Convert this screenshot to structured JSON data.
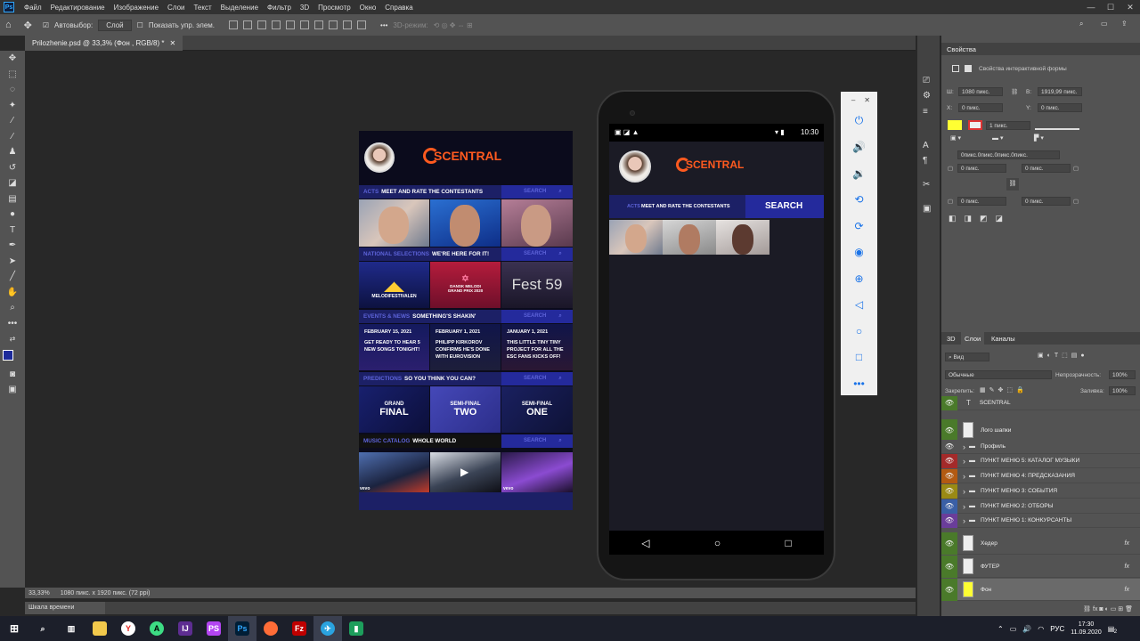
{
  "app": {
    "menu": [
      "Файл",
      "Редактирование",
      "Изображение",
      "Слои",
      "Текст",
      "Выделение",
      "Фильтр",
      "3D",
      "Просмотр",
      "Окно",
      "Справка"
    ]
  },
  "options": {
    "autoselect": "Автовыбор:",
    "layer_select": "Слой",
    "show_controls": "Показать упр. элем.",
    "mode3d": "3D-режим:"
  },
  "document": {
    "tab_title": "Prilozhenie.psd @ 33,3% (Фон , RGB/8) *"
  },
  "status": {
    "zoom": "33,33%",
    "doc_info": "1080 пикс. x 1920 пикс. (72 ppi)"
  },
  "timeline": {
    "label": "Шкала времени"
  },
  "design": {
    "logo": "SCENTRAL",
    "sections": [
      {
        "key": "ACTS",
        "title": "MEET AND RATE THE CONTESTANTS",
        "search": "SEARCH"
      },
      {
        "key": "NATIONAL SELECTIONS",
        "title": "WE'RE HERE FOR IT!",
        "search": "SEARCH"
      },
      {
        "key": "EVENTS & NEWS",
        "title": "SOMETHING'S SHAKIN'",
        "search": "SEARCH"
      },
      {
        "key": "PREDICTIONS",
        "title": "SO YOU THINK YOU CAN?",
        "search": "SEARCH"
      },
      {
        "key": "MUSIC CATALOG",
        "title": "WHOLE WORLD",
        "search": "SEARCH"
      }
    ],
    "selections": [
      "MELODIFESTIVALEN",
      "DANSK MELODI GRAND PRIX 2020",
      "Fest 59"
    ],
    "events": [
      {
        "date": "FEBRUARY 15, 2021",
        "text": "GET READY TO HEAR 5 NEW SONGS TONIGHT!"
      },
      {
        "date": "FEBRUARY 1, 2021",
        "text": "PHILIPP KIRKOROV CONFIRMS HE'S DONE WITH EUROVISION"
      },
      {
        "date": "JANUARY 1, 2021",
        "text": "THIS LITTLE TINY TINY PROJECT FOR ALL THE ESC FANS KICKS OFF!"
      }
    ],
    "predictions": [
      {
        "l1": "GRAND",
        "l2": "FINAL"
      },
      {
        "l1": "SEMI-FINAL",
        "l2": "TWO"
      },
      {
        "l1": "SEMI-FINAL",
        "l2": "ONE"
      }
    ],
    "music_labels": [
      "vevo",
      "vevo",
      "vevo"
    ]
  },
  "phone": {
    "time": "10:30",
    "logo": "SCENTRAL",
    "acts_key": "ACTS",
    "acts_title": "MEET AND RATE THE CONTESTANTS",
    "search": "SEARCH"
  },
  "panel": {
    "tabs": [
      "Свойства"
    ],
    "subtitle": "Свойства интерактивной формы",
    "w_label": "Ш:",
    "w": "1080 пикс.",
    "h_label": "В:",
    "h": "1919,99 пикс.",
    "x_label": "X:",
    "x": "0 пикс.",
    "y_label": "Y:",
    "y": "0 пикс.",
    "stroke": "1 пикс.",
    "radius_all": "0пикс.0пикс.0пикс.0пикс.",
    "r1": "0 пикс.",
    "r2": "0 пикс.",
    "r3": "0 пикс.",
    "r4": "0 пикс."
  },
  "layers_panel": {
    "tabs": [
      "3D",
      "Слои",
      "Каналы"
    ],
    "filter": "Вид",
    "blend": "Обычные",
    "opacity_label": "Непрозрачность:",
    "opacity": "100%",
    "lock_label": "Закрепить:",
    "fill_label": "Заливка:",
    "fill": "100%",
    "layers": [
      {
        "name": "SCENTRAL",
        "color": "#4a7a2a",
        "kind": "text"
      },
      {
        "name": "Лого шапки",
        "color": "#4a7a2a",
        "kind": "image"
      },
      {
        "name": "Профиль",
        "color": "",
        "kind": "folder"
      },
      {
        "name": "ПУНКТ МЕНЮ 5: КАТАЛОГ МУЗЫКИ",
        "color": "#a32a2a",
        "kind": "folder"
      },
      {
        "name": "ПУНКТ МЕНЮ 4: ПРЕДСКАЗАНИЯ",
        "color": "#b35a12",
        "kind": "folder"
      },
      {
        "name": "ПУНКТ МЕНЮ 3: СОБЫТИЯ",
        "color": "#9a8a14",
        "kind": "folder"
      },
      {
        "name": "ПУНКТ МЕНЮ 2: ОТБОРЫ",
        "color": "#3a5fa5",
        "kind": "folder"
      },
      {
        "name": "ПУНКТ МЕНЮ 1: КОНКУРСАНТЫ",
        "color": "#6a3d9a",
        "kind": "folder"
      },
      {
        "name": "Хедер",
        "color": "#4a7a2a",
        "kind": "image"
      },
      {
        "name": "ФУТЕР",
        "color": "#4a7a2a",
        "kind": "image"
      },
      {
        "name": "Фон",
        "color": "#4a7a2a",
        "kind": "image"
      }
    ]
  },
  "taskbar": {
    "lang": "РУС",
    "time": "17:30",
    "date": "11.09.2020",
    "notif": "2"
  },
  "colors": {
    "accent": "#ff5a1f",
    "navy": "#1c2066",
    "brand_blue": "#242a9c",
    "fg_swatch": "#1d2b9a",
    "shape_fill": "#ffff33"
  }
}
